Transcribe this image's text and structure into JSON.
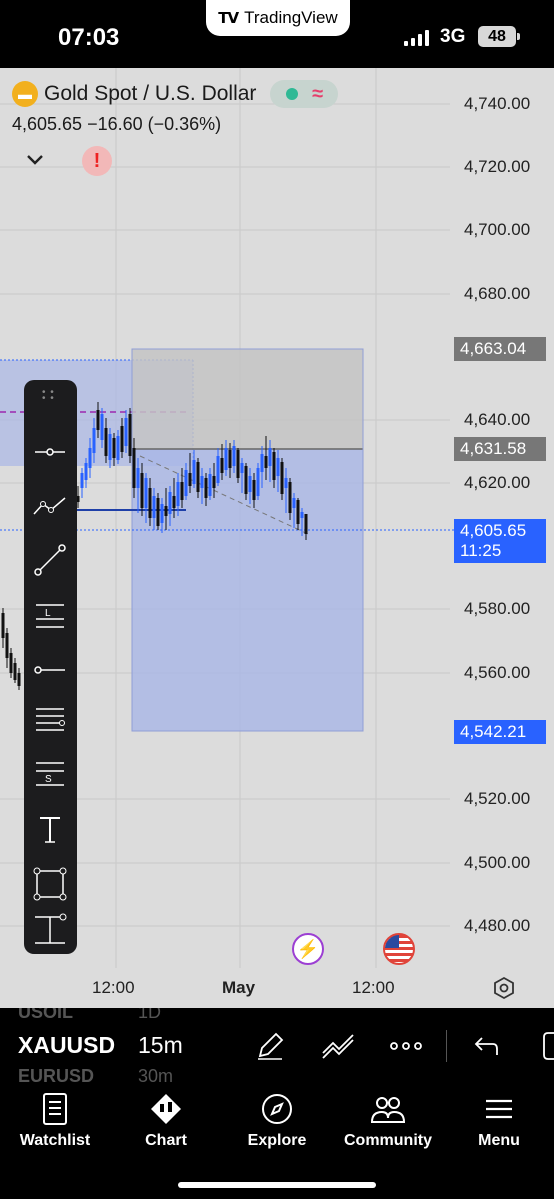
{
  "status_bar": {
    "time": "07:03",
    "app_pill": "TradingView",
    "network": "3G",
    "battery": "48"
  },
  "header": {
    "symbol_name": "Gold Spot / U.S. Dollar",
    "price_line": "4,605.65  −16.60 (−0.36%)",
    "icons": [
      "gold-bars-icon",
      "market-status-dot-icon",
      "wave-icon",
      "chevron-down-icon",
      "alert-icon"
    ]
  },
  "price_axis": {
    "labels": [
      "4,740.00",
      "4,720.00",
      "4,700.00",
      "4,680.00",
      "4,640.00",
      "4,620.00",
      "4,580.00",
      "4,560.00",
      "4,520.00",
      "4,500.00",
      "4,480.00"
    ],
    "tags": {
      "stop": {
        "text": "4,663.04",
        "color": "#777777"
      },
      "entry": {
        "text": "4,631.58",
        "color": "#777777"
      },
      "current": {
        "text": "4,605.65",
        "countdown": "11:25",
        "color": "#2962ff"
      },
      "target": {
        "text": "4,542.21",
        "color": "#2962ff"
      }
    }
  },
  "time_axis": {
    "labels": [
      "12:00",
      "May",
      "12:00"
    ]
  },
  "drawing_tools": [
    "horizontal-line-tool-icon",
    "path-tool-icon",
    "trend-line-tool-icon",
    "long-position-tool-icon",
    "horizontal-ray-tool-icon",
    "fib-retracement-tool-icon",
    "short-position-tool-icon",
    "text-tool-icon",
    "rectangle-tool-icon",
    "price-range-tool-icon"
  ],
  "symbol_bar": {
    "ticker": "XAUUSD",
    "interval": "15m",
    "ghost_top": {
      "ticker": "USOIL",
      "interval": "1D"
    },
    "ghost_bottom": {
      "ticker": "EURUSD",
      "interval": "30m"
    }
  },
  "bottom_nav": {
    "items": [
      {
        "label": "Watchlist",
        "icon": "watchlist-icon"
      },
      {
        "label": "Chart",
        "icon": "chart-icon"
      },
      {
        "label": "Explore",
        "icon": "compass-icon"
      },
      {
        "label": "Community",
        "icon": "community-icon"
      },
      {
        "label": "Menu",
        "icon": "menu-icon"
      }
    ]
  },
  "colors": {
    "up": "#2962ff",
    "down": "#111111",
    "chart_bg": "#dcdcdc",
    "target_zone": "#a9b7e6",
    "stop_zone": "#c4c4c4"
  }
}
